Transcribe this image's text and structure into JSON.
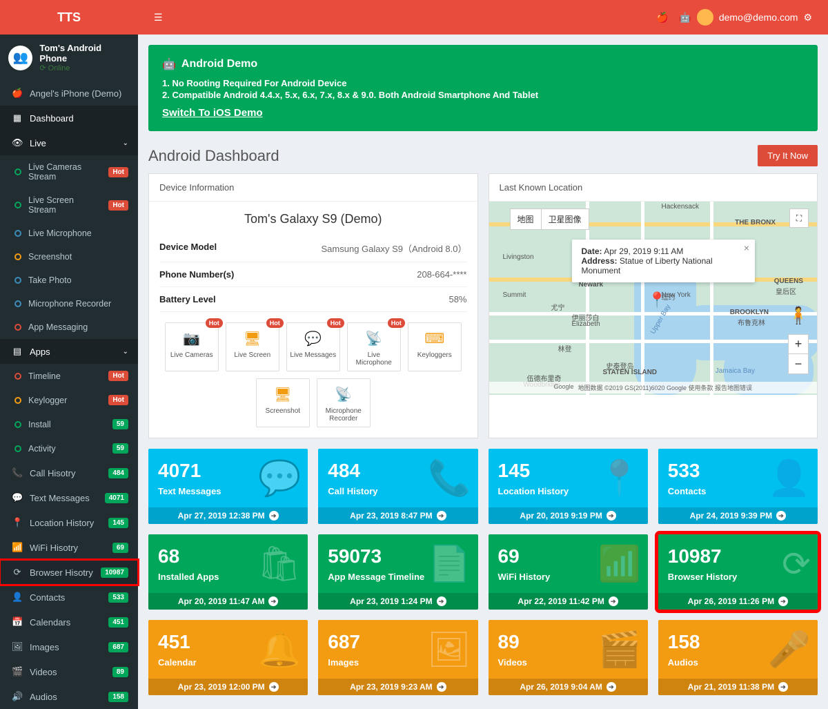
{
  "brand": "TTS",
  "user_email": "demo@demo.com",
  "profile": {
    "name": "Tom's Android Phone",
    "status": "Online"
  },
  "sidebar": {
    "device2": "Angel's iPhone (Demo)",
    "dashboard": "Dashboard",
    "live": {
      "label": "Live",
      "items": [
        {
          "label": "Live Cameras Stream",
          "badge": "Hot",
          "btype": "hot",
          "c": "green"
        },
        {
          "label": "Live Screen Stream",
          "badge": "Hot",
          "btype": "hot",
          "c": "green"
        },
        {
          "label": "Live Microphone",
          "c": "blue"
        },
        {
          "label": "Screenshot",
          "c": "yellow"
        },
        {
          "label": "Take Photo",
          "c": "blue"
        },
        {
          "label": "Microphone Recorder",
          "c": "blue"
        },
        {
          "label": "App Messaging",
          "c": "red"
        }
      ]
    },
    "apps": {
      "label": "Apps",
      "items": [
        {
          "label": "Timeline",
          "badge": "Hot",
          "btype": "hot",
          "c": "red"
        },
        {
          "label": "Keylogger",
          "badge": "Hot",
          "btype": "hot",
          "c": "yellow"
        },
        {
          "label": "Install",
          "badge": "59",
          "btype": "green",
          "c": "green"
        },
        {
          "label": "Activity",
          "badge": "59",
          "btype": "green",
          "c": "green"
        }
      ]
    },
    "rest": [
      {
        "icon": "📞",
        "label": "Call Hisotry",
        "badge": "484"
      },
      {
        "icon": "💬",
        "label": "Text Messages",
        "badge": "4071"
      },
      {
        "icon": "📍",
        "label": "Location History",
        "badge": "145"
      },
      {
        "icon": "📶",
        "label": "WiFi Hisotry",
        "badge": "69"
      },
      {
        "icon": "⟳",
        "label": "Browser Hisotry",
        "badge": "10987",
        "hl": true
      },
      {
        "icon": "👤",
        "label": "Contacts",
        "badge": "533"
      },
      {
        "icon": "📅",
        "label": "Calendars",
        "badge": "451"
      },
      {
        "icon": "🖼",
        "label": "Images",
        "badge": "687"
      },
      {
        "icon": "🎬",
        "label": "Videos",
        "badge": "89"
      },
      {
        "icon": "🔊",
        "label": "Audios",
        "badge": "158"
      }
    ]
  },
  "banner": {
    "title": "Android Demo",
    "line1": "1. No Rooting Required For Android Device",
    "line2": "2. Compatible Android 4.4.x, 5.x, 6.x, 7.x, 8.x & 9.0. Both Android Smartphone And Tablet",
    "link": "Switch To iOS Demo"
  },
  "page": {
    "title": "Android Dashboard",
    "try": "Try It Now"
  },
  "device": {
    "panel_title": "Device Information",
    "name": "Tom's Galaxy S9 (Demo)",
    "rows": {
      "model_k": "Device Model",
      "model_v": "Samsung Galaxy S9（Android 8.0）",
      "phone_k": "Phone Number(s)",
      "phone_v": "208-664-****",
      "batt_k": "Battery Level",
      "batt_v": "58%"
    },
    "quick": [
      {
        "label": "Live Cameras",
        "icon": "📷",
        "hot": true
      },
      {
        "label": "Live Screen",
        "icon": "🖥",
        "hot": true
      },
      {
        "label": "Live Messages",
        "icon": "💬",
        "hot": true
      },
      {
        "label": "Live Microphone",
        "icon": "📡",
        "hot": true
      },
      {
        "label": "Keyloggers",
        "icon": "⌨"
      },
      {
        "label": "Screenshot",
        "icon": "🖥"
      },
      {
        "label": "Microphone Recorder",
        "icon": "📡"
      }
    ],
    "hot_label": "Hot"
  },
  "map": {
    "panel_title": "Last Known Location",
    "tab1": "地图",
    "tab2": "卫星图像",
    "info_date_k": "Date:",
    "info_date_v": "Apr 29, 2019 9:11 AM",
    "info_addr_k": "Address:",
    "info_addr_v": "Statue of Liberty National Monument",
    "labels": {
      "hackensack": "Hackensack",
      "bronx": "THE BRONX",
      "livingston": "Livingston",
      "newark": "Newark",
      "newyork": "New York",
      "chinese_ny": "纽约",
      "summit": "Summit",
      "union": "尤宁",
      "elizabeth_cn": "伊丽莎白",
      "elizabeth": "Elizabeth",
      "linden": "林登",
      "brooklyn": "BROOKLYN",
      "chinese_bk": "布鲁克林",
      "staten_cn": "史泰登岛",
      "staten": "STATEN ISLAND",
      "woodbridge_cn": "伍德布里奇",
      "woodbridge": "Woodbridge",
      "queens": "QUEENS",
      "queens_cn": "皇后区",
      "upper_bay": "Upper Bay",
      "jamaica": "Jamaica Bay"
    },
    "copyright": "地图数据 ©2019 GS(2011)6020 Google  使用条款  报告地图错误",
    "google": "Google"
  },
  "stats": [
    {
      "num": "4071",
      "label": "Text Messages",
      "time": "Apr 27, 2019 12:38 PM",
      "color": "blue",
      "icon": "💬"
    },
    {
      "num": "484",
      "label": "Call History",
      "time": "Apr 23, 2019 8:47 PM",
      "color": "blue",
      "icon": "📞"
    },
    {
      "num": "145",
      "label": "Location History",
      "time": "Apr 20, 2019 9:19 PM",
      "color": "blue",
      "icon": "📍"
    },
    {
      "num": "533",
      "label": "Contacts",
      "time": "Apr 24, 2019 9:39 PM",
      "color": "blue",
      "icon": "👤"
    },
    {
      "num": "68",
      "label": "Installed Apps",
      "time": "Apr 20, 2019 11:47 AM",
      "color": "green",
      "icon": "🛍"
    },
    {
      "num": "59073",
      "label": "App Message Timeline",
      "time": "Apr 23, 2019 1:24 PM",
      "color": "green",
      "icon": "📄"
    },
    {
      "num": "69",
      "label": "WiFi History",
      "time": "Apr 22, 2019 11:42 PM",
      "color": "green",
      "icon": "📶"
    },
    {
      "num": "10987",
      "label": "Browser History",
      "time": "Apr 26, 2019 11:26 PM",
      "color": "green",
      "icon": "⟳",
      "hl": true
    },
    {
      "num": "451",
      "label": "Calendar",
      "time": "Apr 23, 2019 12:00 PM",
      "color": "yellow",
      "icon": "🔔"
    },
    {
      "num": "687",
      "label": "Images",
      "time": "Apr 23, 2019 9:23 AM",
      "color": "yellow",
      "icon": "🖼"
    },
    {
      "num": "89",
      "label": "Videos",
      "time": "Apr 26, 2019 9:04 AM",
      "color": "yellow",
      "icon": "🎬"
    },
    {
      "num": "158",
      "label": "Audios",
      "time": "Apr 21, 2019 11:38 PM",
      "color": "yellow",
      "icon": "🎤"
    }
  ]
}
